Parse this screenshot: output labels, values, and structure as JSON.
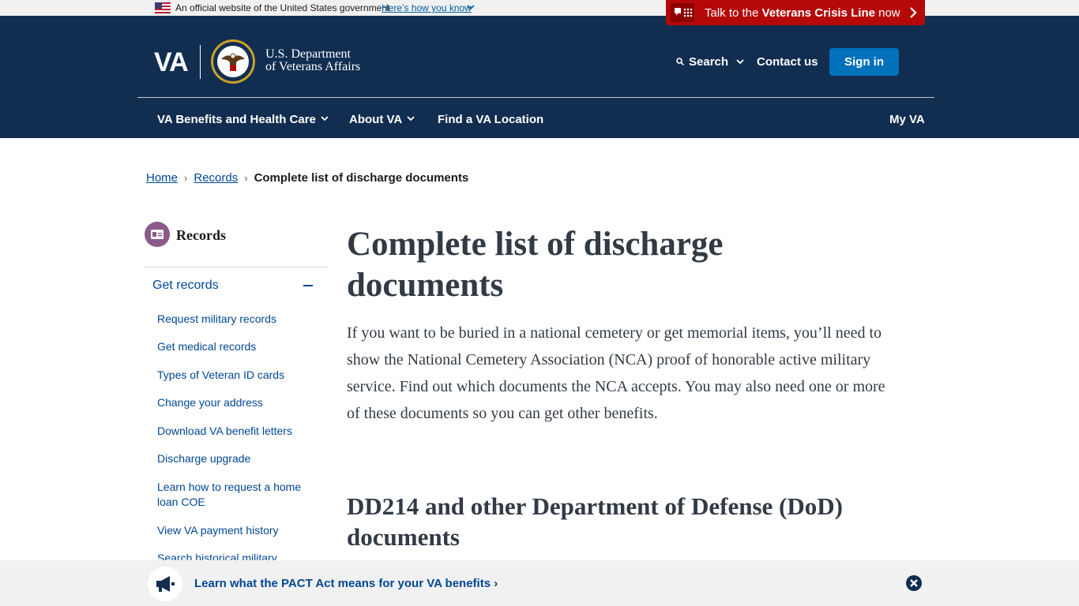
{
  "gov_banner": {
    "text": "An official website of the United States government",
    "link": "Here’s how you know"
  },
  "crisis": {
    "prefix": "Talk to the ",
    "strong": "Veterans Crisis Line",
    "suffix": " now"
  },
  "header": {
    "logo": "VA",
    "dept_line1": "U.S. Department",
    "dept_line2": "of Veterans Affairs",
    "search": "Search",
    "contact": "Contact us",
    "signin": "Sign in"
  },
  "nav": {
    "benefits": "VA Benefits and Health Care",
    "about": "About VA",
    "find": "Find a VA Location",
    "myva": "My VA"
  },
  "breadcrumb": {
    "home": "Home",
    "records": "Records",
    "current": "Complete list of discharge documents"
  },
  "sidebar": {
    "title": "Records",
    "section": "Get records",
    "items": [
      {
        "label": "Request military records"
      },
      {
        "label": "Get medical records"
      },
      {
        "label": "Types of Veteran ID cards"
      },
      {
        "label": "Change your address"
      },
      {
        "label": "Download VA benefit letters"
      },
      {
        "label": "Discharge upgrade"
      },
      {
        "label": "Learn how to request a home loan COE"
      },
      {
        "label": "View VA payment history"
      },
      {
        "label": "Search historical military"
      }
    ]
  },
  "main": {
    "title": "Complete list of discharge documents",
    "intro": "If you want to be buried in a national cemetery or get memorial items, you’ll need to show the National Cemetery Association (NCA) proof of honorable active military service. Find out which documents the NCA accepts. You may also need one or more of these documents so you can get other benefits.",
    "h2": "DD214 and other Department of Defense (DoD) documents"
  },
  "pact": {
    "text": "Learn what the PACT Act means for your VA benefits"
  },
  "colors": {
    "header": "#112e51",
    "crisis": "#b50909",
    "link": "#004795",
    "signin": "#0071bb"
  }
}
